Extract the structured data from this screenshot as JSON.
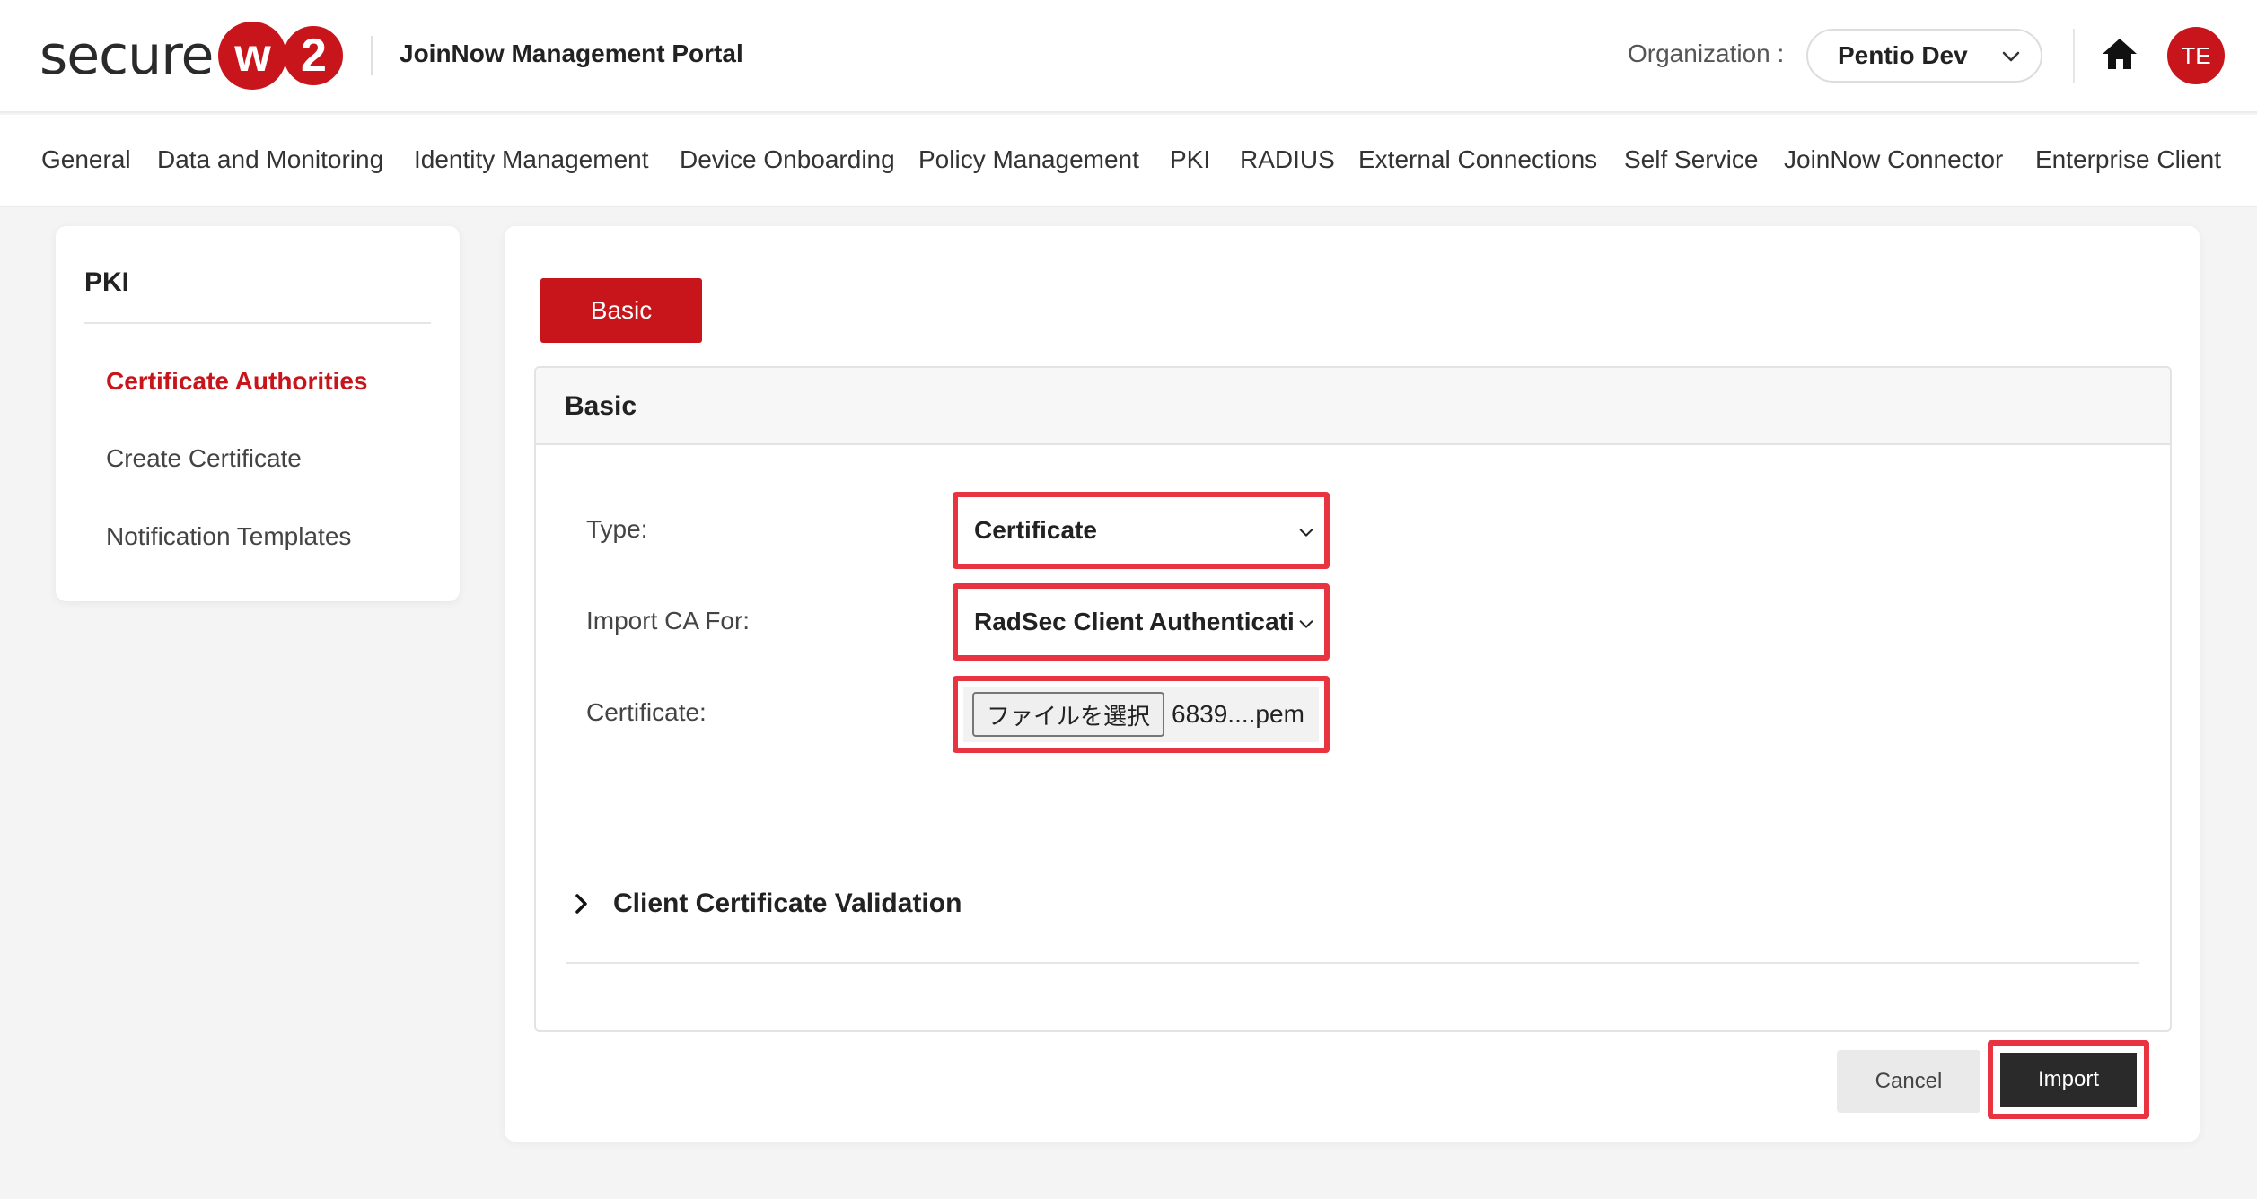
{
  "header": {
    "logo_text": "secure",
    "logo_w": "w",
    "logo_2": "2",
    "portal_title": "JoinNow Management Portal",
    "org_label": "Organization :",
    "org_value": "Pentio Dev",
    "avatar_initials": "TE"
  },
  "nav": {
    "items": [
      "General",
      "Data and Monitoring",
      "Identity Management",
      "Device Onboarding",
      "Policy Management",
      "PKI",
      "RADIUS",
      "External Connections",
      "Self Service",
      "JoinNow Connector",
      "Enterprise Client"
    ]
  },
  "sidebar": {
    "title": "PKI",
    "items": [
      "Certificate Authorities",
      "Create Certificate",
      "Notification Templates"
    ]
  },
  "main": {
    "tab_label": "Basic",
    "card_title": "Basic",
    "type_label": "Type:",
    "type_value": "Certificate",
    "import_for_label": "Import CA For:",
    "import_for_value": "RadSec Client Authentication",
    "certificate_label": "Certificate:",
    "file_button": "ファイルを選択",
    "file_name": "6839....pem",
    "ccv_label": "Client Certificate Validation",
    "cancel_label": "Cancel",
    "import_label": "Import"
  },
  "colors": {
    "brand_red": "#c8151b",
    "highlight_red": "#e83341",
    "dark_button": "#2a2a2a"
  }
}
